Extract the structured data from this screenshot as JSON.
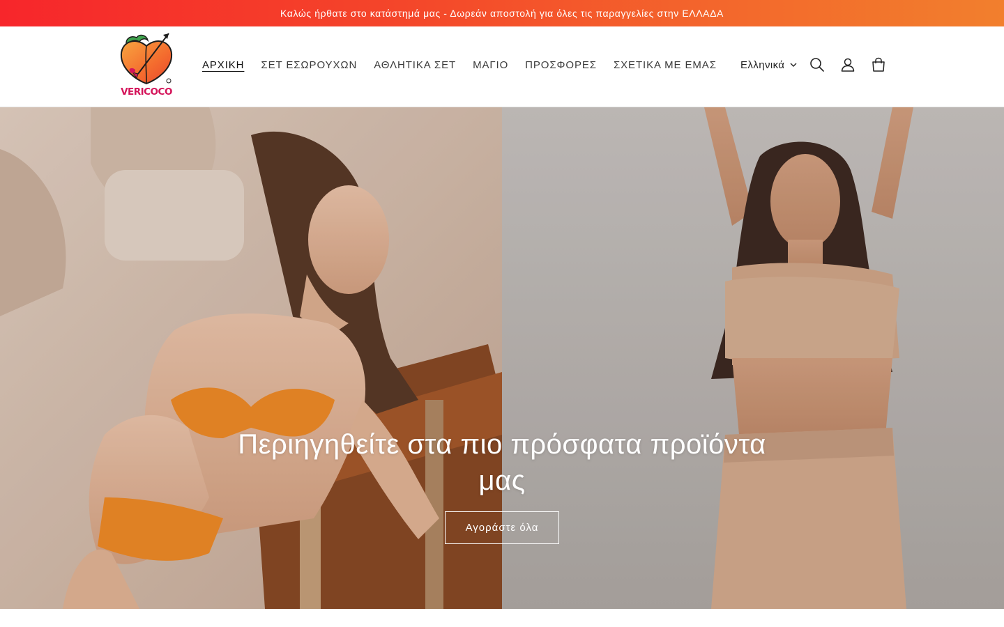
{
  "announcement": {
    "text": "Καλώς ήρθατε στο κατάστημά μας - Δωρεάν αποστολή για όλες τις παραγγελίες στην ΕΛΛΑΔΑ"
  },
  "brand": {
    "logo_text": "VERICOCO",
    "logo_color": "#d4145a",
    "peach_color": "#f46b2e"
  },
  "nav": {
    "items": [
      {
        "label": "ΑΡΧΙΚΗ"
      },
      {
        "label": "ΣΕΤ ΕΣΩΡΟΥΧΩΝ"
      },
      {
        "label": "ΑΘΛΗΤΙΚΑ ΣΕΤ"
      },
      {
        "label": "ΜΑΓΙΟ"
      },
      {
        "label": "ΠΡΟΣΦΟΡΕΣ"
      },
      {
        "label": "ΣΧΕΤΙΚΑ ΜΕ ΕΜΑΣ"
      }
    ]
  },
  "header_tools": {
    "language_label": "Ελληνικά",
    "icons": [
      "chevron-down-icon",
      "search-icon",
      "account-icon",
      "cart-icon"
    ]
  },
  "hero": {
    "heading": "Περιηγηθείτε στα πιο πρόσφατα προϊόντα μας",
    "cta_label": "Αγοράστε όλα"
  },
  "colors": {
    "announcement_start": "#f7262b",
    "announcement_end": "#f27f2d",
    "hero_left_bg": "#d9c3b4",
    "hero_right_bg": "#bdb7b3"
  }
}
